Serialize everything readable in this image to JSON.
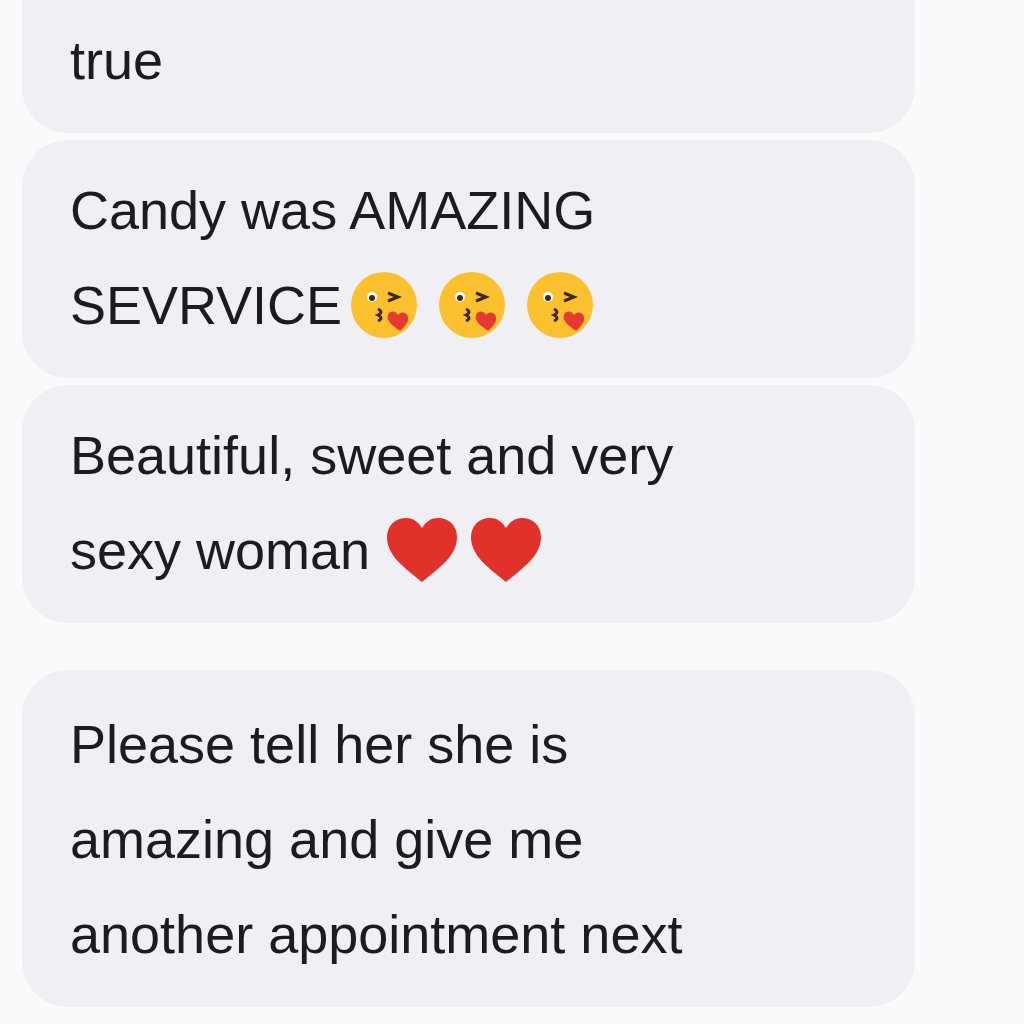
{
  "messages": [
    {
      "cut_top": true,
      "lines": [
        [
          {
            "kind": "text",
            "text": "true"
          }
        ]
      ]
    },
    {
      "cut_top": false,
      "lines": [
        [
          {
            "kind": "text",
            "text": "Candy was AMAZING"
          }
        ],
        [
          {
            "kind": "text",
            "text": "SEVRVICE"
          },
          {
            "kind": "kiss"
          },
          {
            "kind": "kiss"
          },
          {
            "kind": "kiss"
          }
        ]
      ]
    },
    {
      "cut_top": false,
      "lines": [
        [
          {
            "kind": "text",
            "text": "Beautiful, sweet and very"
          }
        ],
        [
          {
            "kind": "text",
            "text": "sexy woman "
          },
          {
            "kind": "heart"
          },
          {
            "kind": "heart"
          }
        ]
      ]
    },
    {
      "cut_top": false,
      "gap_before": true,
      "lines": [
        [
          {
            "kind": "text",
            "text": "Please tell her she is"
          }
        ],
        [
          {
            "kind": "text",
            "text": "amazing and give me"
          }
        ],
        [
          {
            "kind": "text",
            "text": "another appointment next"
          }
        ]
      ]
    }
  ]
}
